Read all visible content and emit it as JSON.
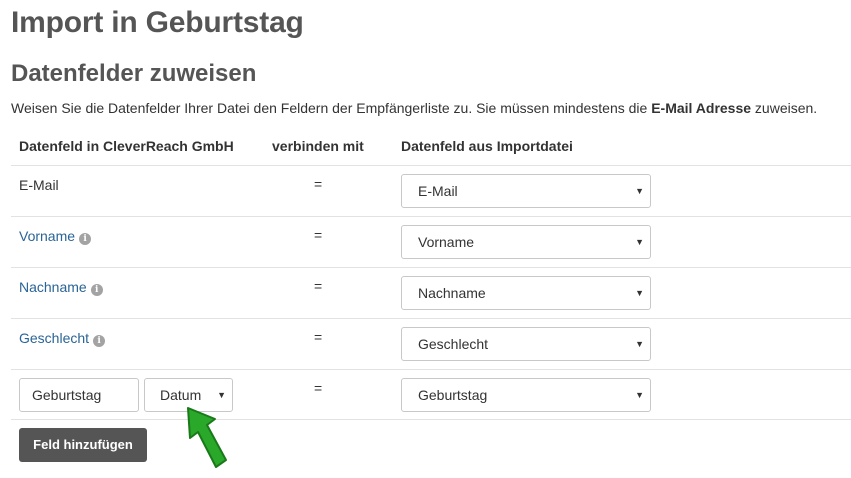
{
  "page_title": "Import in Geburtstag",
  "section_title": "Datenfelder zuweisen",
  "intro": {
    "text_before": "Weisen Sie die Datenfelder Ihrer Datei den Feldern der Empfängerliste zu. Sie müssen mindestens die ",
    "bold": "E-Mail Adresse",
    "text_after": " zuweisen."
  },
  "table": {
    "headers": [
      "Datenfeld in CleverReach GmbH",
      "verbinden mit",
      "Datenfeld aus Importdatei"
    ],
    "rows": [
      {
        "label": "E-Mail",
        "eq": "=",
        "selected": "E-Mail"
      },
      {
        "label": "Vorname",
        "eq": "=",
        "selected": "Vorname"
      },
      {
        "label": "Nachname",
        "eq": "=",
        "selected": "Nachname"
      },
      {
        "label": "Geschlecht",
        "eq": "=",
        "selected": "Geschlecht"
      },
      {
        "new_field_name": "Geburtstag",
        "type_selected": "Datum",
        "eq": "=",
        "selected": "Geburtstag"
      }
    ]
  },
  "add_field_button": "Feld hinzufügen",
  "icons": {
    "info": "info-circle-icon",
    "caret": "caret-down-icon",
    "arrow": "green-arrow-icon"
  },
  "colors": {
    "link": "#2a6496",
    "button_bg": "#555555",
    "arrow": "#2aa82a"
  }
}
